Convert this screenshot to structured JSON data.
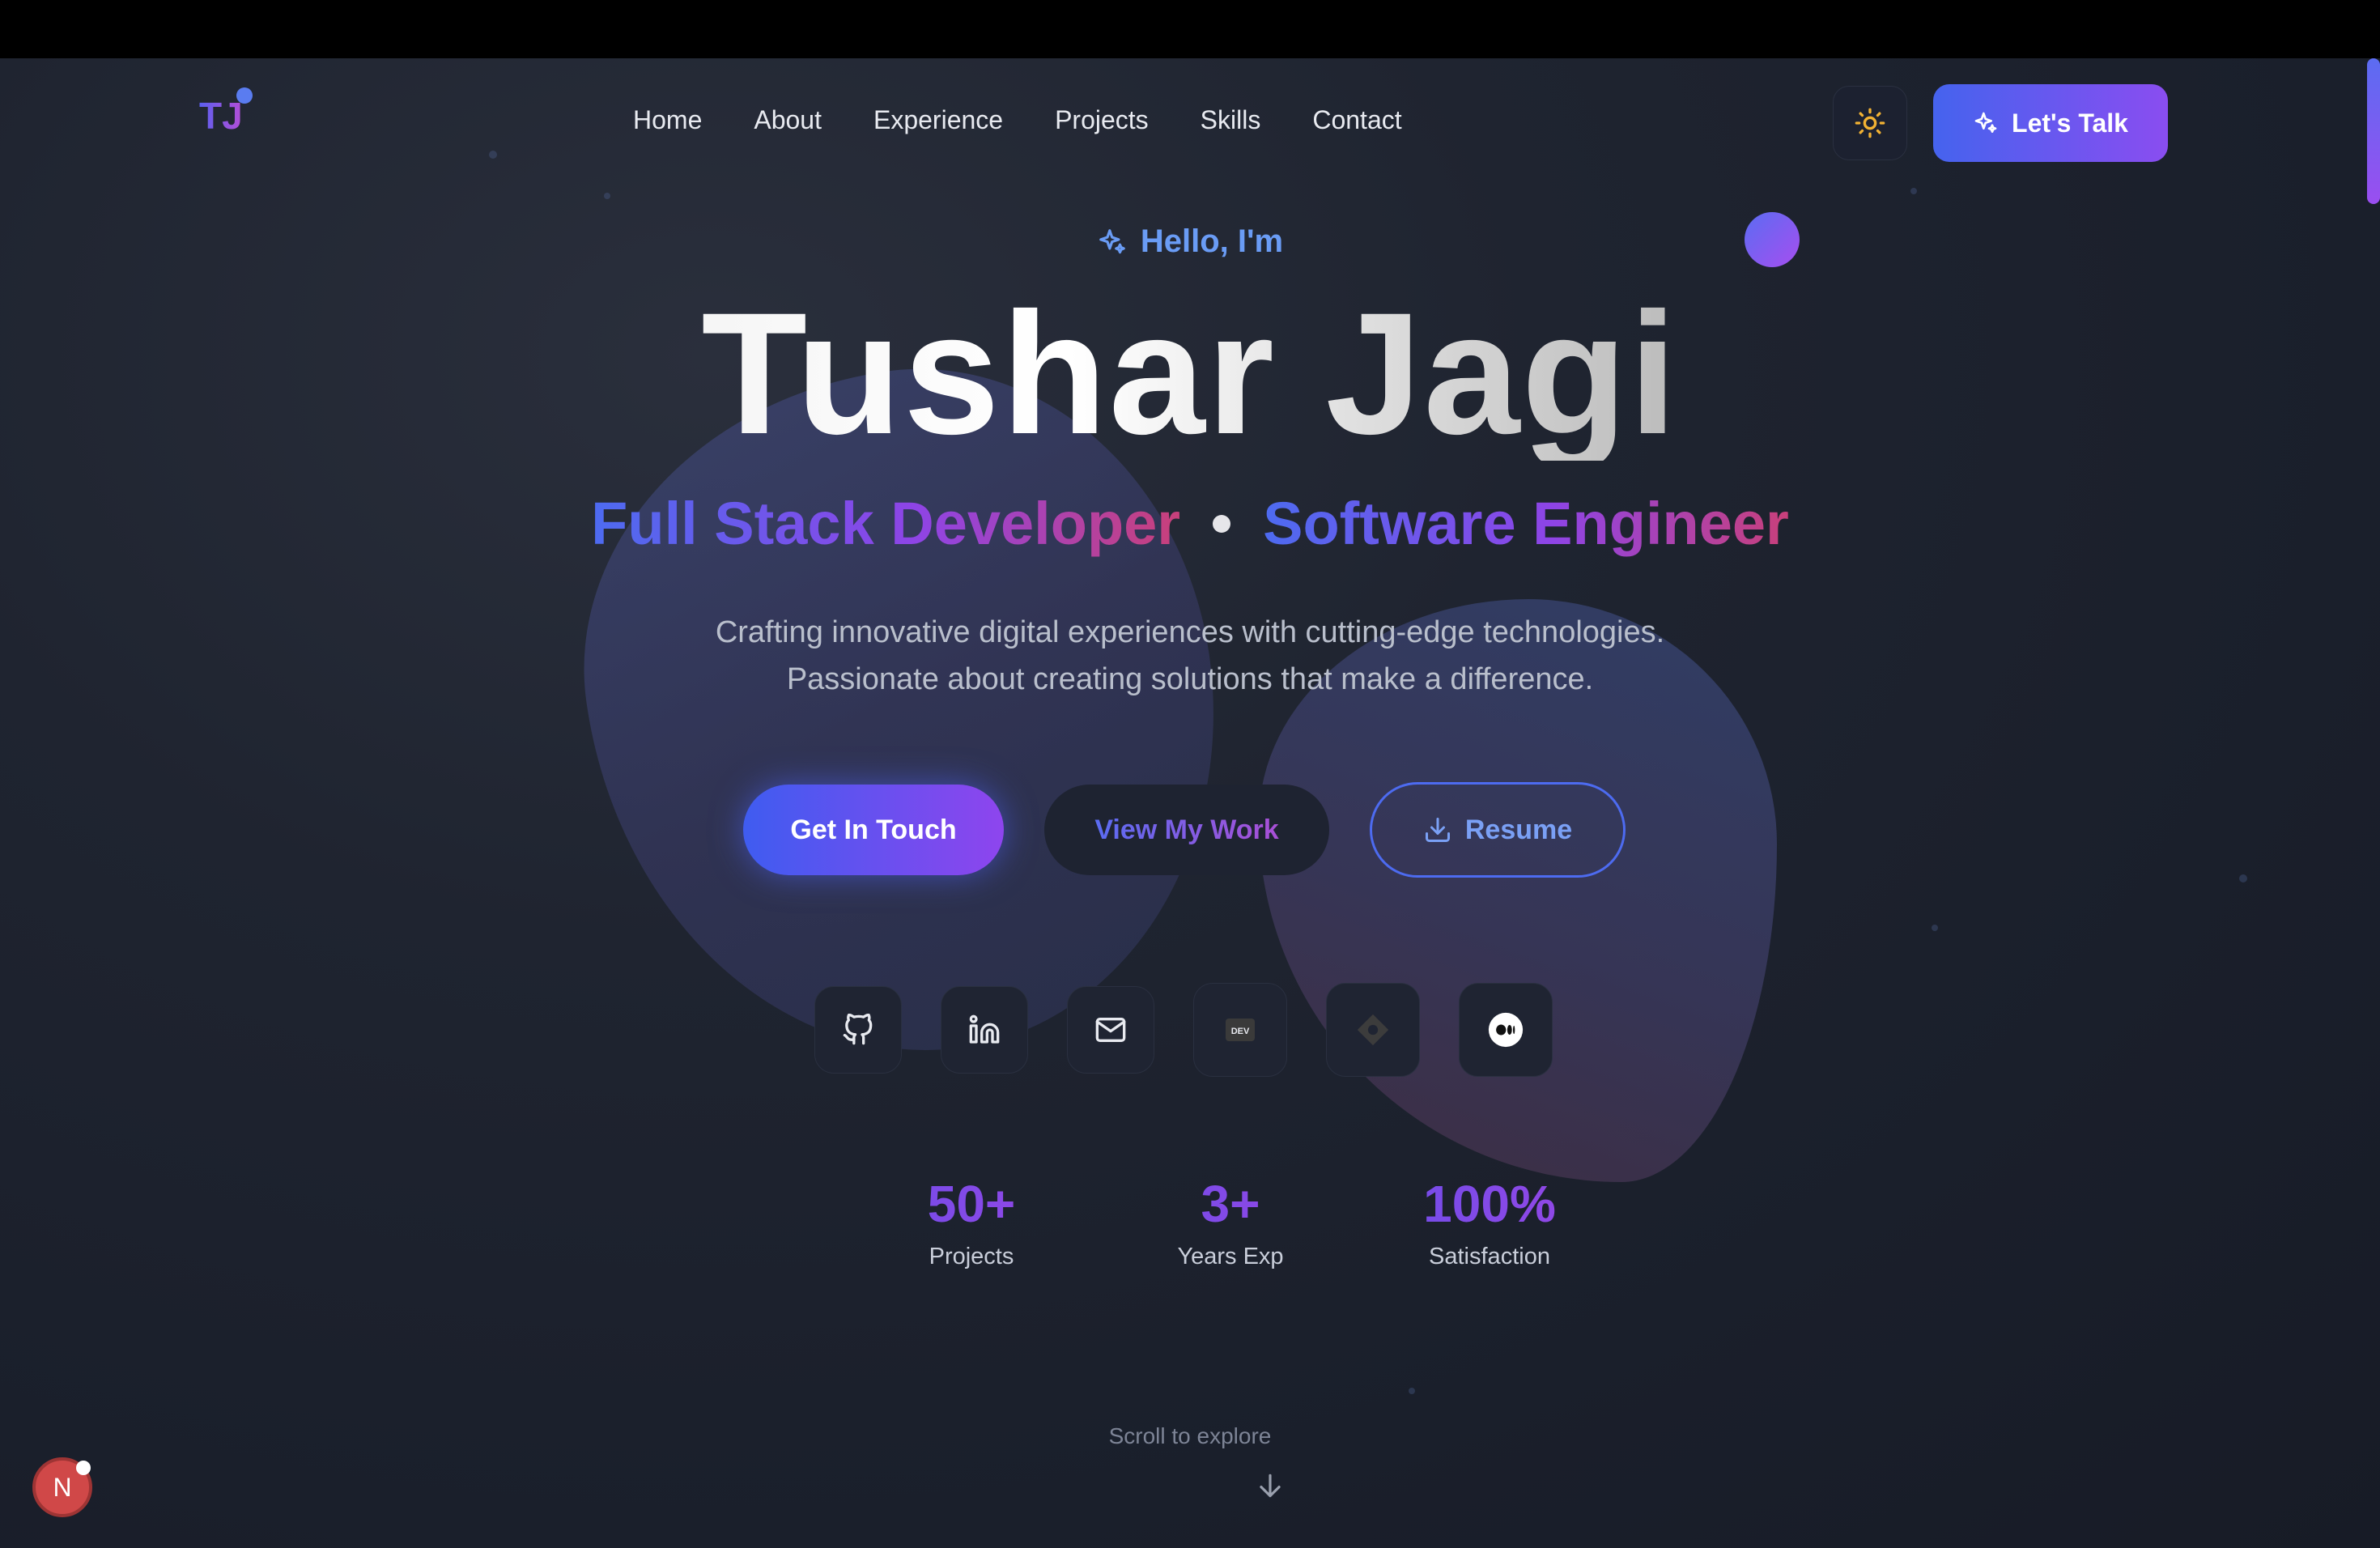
{
  "brand": {
    "logo": "TJ"
  },
  "nav": {
    "items": [
      "Home",
      "About",
      "Experience",
      "Projects",
      "Skills",
      "Contact"
    ],
    "theme_icon": "sun-icon",
    "cta_label": "Let's Talk",
    "cta_icon": "sparkles-icon"
  },
  "hero": {
    "greeting": "Hello, I'm",
    "greeting_icon": "sparkles-icon",
    "name": "Tushar Jagi",
    "roles": [
      "Full Stack Developer",
      "Software Engineer"
    ],
    "tagline_line1": "Crafting innovative digital experiences with cutting-edge technologies.",
    "tagline_line2": "Passionate about creating solutions that make a difference.",
    "buttons": {
      "primary": "Get In Touch",
      "secondary": "View My Work",
      "resume": "Resume"
    }
  },
  "socials": [
    {
      "name": "github-icon"
    },
    {
      "name": "linkedin-icon"
    },
    {
      "name": "mail-icon"
    },
    {
      "name": "devto-icon",
      "text": "DEV"
    },
    {
      "name": "diamond-icon"
    },
    {
      "name": "medium-icon"
    }
  ],
  "stats": [
    {
      "value": "50+",
      "label": "Projects"
    },
    {
      "value": "3+",
      "label": "Years Exp"
    },
    {
      "value": "100%",
      "label": "Satisfaction"
    }
  ],
  "scroll_hint": "Scroll to explore",
  "badge": {
    "letter": "N"
  },
  "colors": {
    "accent_blue": "#4563ee",
    "accent_purple": "#8a4df0",
    "accent_pink": "#c9407a",
    "background": "#1f2430"
  }
}
